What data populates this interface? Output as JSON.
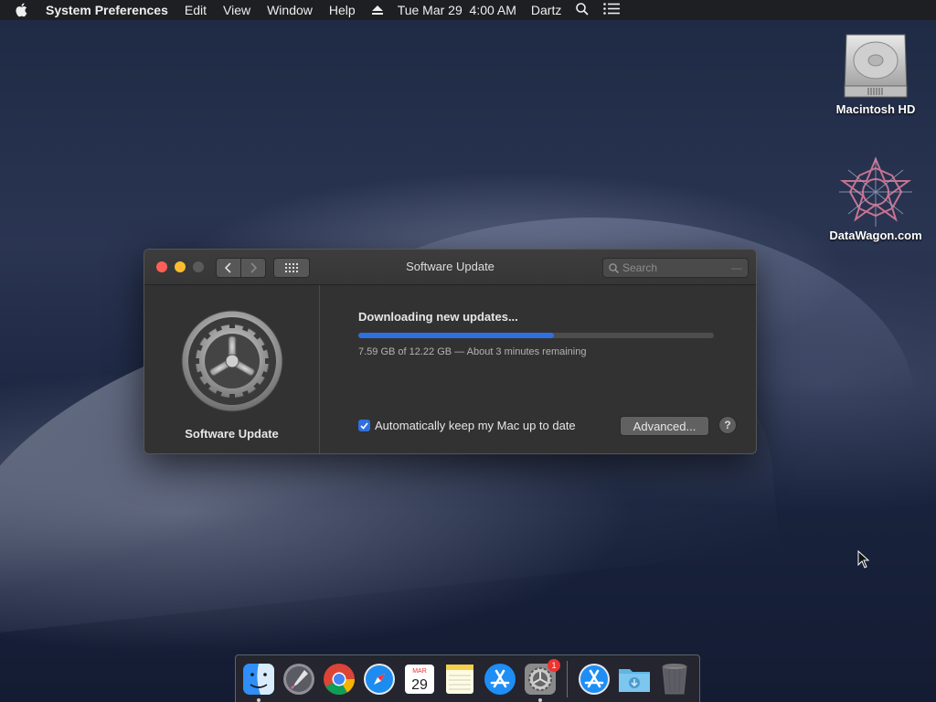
{
  "menubar": {
    "app_name": "System Preferences",
    "menus": [
      "Edit",
      "View",
      "Window",
      "Help"
    ],
    "datetime": "Tue Mar 29  4:00 AM",
    "user": "Dartz"
  },
  "desktop": {
    "icons": [
      {
        "label": "Macintosh HD",
        "icon": "hard-drive-icon"
      },
      {
        "label": "DataWagon.com",
        "icon": "datawagon-logo-icon"
      }
    ]
  },
  "window": {
    "title": "Software Update",
    "search_placeholder": "Search",
    "pane": {
      "label": "Software Update",
      "icon": "gear-icon"
    },
    "status_text": "Downloading new updates...",
    "progress": {
      "downloaded_gb": 7.59,
      "total_gb": 12.22,
      "fraction": 0.55
    },
    "detail_text": "7.59 GB of 12.22 GB — About 3 minutes remaining",
    "auto_update": {
      "label": "Automatically keep my Mac up to date",
      "checked": true
    },
    "advanced_label": "Advanced...",
    "help_label": "?"
  },
  "dock": {
    "items": [
      {
        "name": "Finder",
        "icon": "finder-icon",
        "running": true
      },
      {
        "name": "Launchpad",
        "icon": "launchpad-icon",
        "running": false
      },
      {
        "name": "Google Chrome",
        "icon": "chrome-icon",
        "running": false
      },
      {
        "name": "Safari",
        "icon": "safari-icon",
        "running": false
      },
      {
        "name": "Calendar",
        "icon": "calendar-icon",
        "month": "MAR",
        "day": "29",
        "running": false
      },
      {
        "name": "Notes",
        "icon": "notes-icon",
        "running": false
      },
      {
        "name": "App Store",
        "icon": "app-store-icon",
        "running": false
      },
      {
        "name": "System Preferences",
        "icon": "system-preferences-icon",
        "badge": "1",
        "running": true
      },
      {
        "name": "App Store",
        "icon": "app-store-icon",
        "running": false
      },
      {
        "name": "Downloads",
        "icon": "downloads-folder-icon",
        "running": false
      },
      {
        "name": "Trash",
        "icon": "trash-icon",
        "running": false
      }
    ]
  },
  "colors": {
    "accent": "#2f6fe0",
    "close": "#ff5f57",
    "minimize": "#febc2e",
    "zoom_disabled": "#5a5a5a"
  }
}
